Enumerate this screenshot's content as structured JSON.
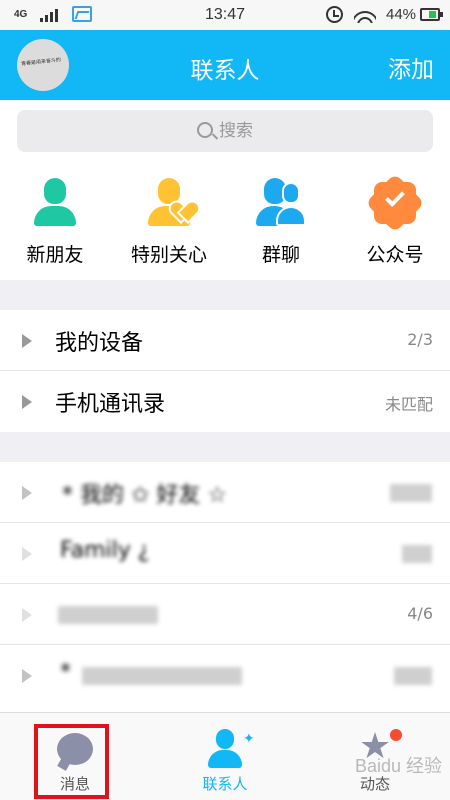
{
  "status_bar": {
    "network": "4G",
    "time": "13:47",
    "battery": "44%"
  },
  "header": {
    "avatar_text": "青春是用来奋斗的",
    "title": "联系人",
    "add_label": "添加"
  },
  "search": {
    "placeholder": "搜索"
  },
  "quick_actions": [
    {
      "label": "新朋友",
      "icon": "new-friend-icon",
      "color": "#1fc8a2"
    },
    {
      "label": "特别关心",
      "icon": "special-care-icon",
      "color": "#ffc233"
    },
    {
      "label": "群聊",
      "icon": "group-chat-icon",
      "color": "#1ca9f0"
    },
    {
      "label": "公众号",
      "icon": "official-account-icon",
      "color": "#ff8a3d"
    }
  ],
  "devices": [
    {
      "name": "我的设备",
      "count": "2/3"
    },
    {
      "name": "手机通讯录",
      "count": "未匹配"
    }
  ],
  "groups": [
    {
      "name": "* 我的 ✩ 好友 ☆",
      "count": ""
    },
    {
      "name": "Family ¿",
      "count": ""
    },
    {
      "name": "",
      "count": "4/6"
    },
    {
      "name": "* ",
      "count": ""
    }
  ],
  "tabbar": {
    "messages_label": "消息",
    "contacts_label": "联系人",
    "feed_label": "动态"
  },
  "watermark": "Baidu 经验",
  "colors": {
    "brand": "#12b7f5",
    "highlight": "#e0131a"
  }
}
